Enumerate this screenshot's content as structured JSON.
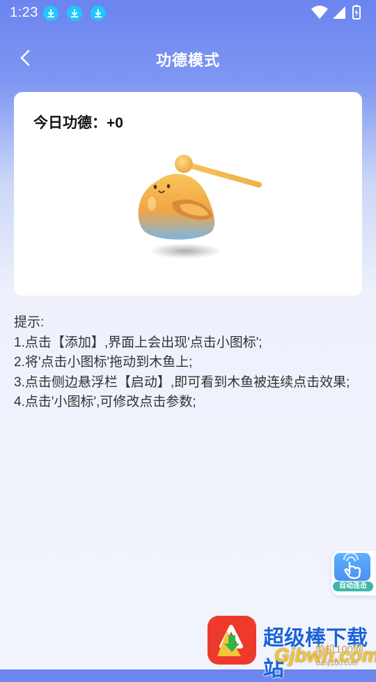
{
  "status_bar": {
    "time": "1:23",
    "download_icons": [
      "download-icon",
      "download-icon",
      "download-icon"
    ],
    "right_icons": [
      "wifi-icon",
      "cell-signal-icon",
      "battery-charging-icon"
    ]
  },
  "header": {
    "title": "功德模式",
    "back_icon": "chevron-left-icon"
  },
  "merit_card": {
    "label": "今日功德：+0"
  },
  "tips": {
    "heading": "提示:",
    "lines": [
      "1.点击【添加】,界面上会出现'点击小图标';",
      "2.将'点击小图标'拖动到木鱼上;",
      "3.点击侧边悬浮栏【启动】,即可看到木鱼被连续点击效果;",
      "4.点击'小图标',可修改点击参数;"
    ]
  },
  "float_button": {
    "label": "自动连击",
    "icon": "hand-tap-icon"
  },
  "watermark": {
    "title": "超级棒下载站",
    "site": "Gjbwh.com",
    "cn_text": "单机100网",
    "domain": "danji100.com"
  },
  "colors": {
    "header_gradient_top": "#6b84ef",
    "background_bottom": "#f2f4fd",
    "download_badge": "#1ec8ff",
    "float_label_bg": "#3fb6a8",
    "watermark_blue": "#1a63d8",
    "watermark_red": "#ee3a2c"
  }
}
